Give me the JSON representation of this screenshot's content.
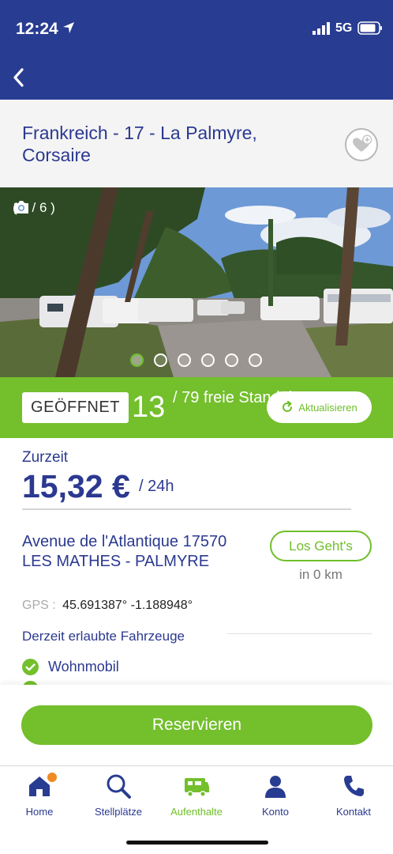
{
  "status_bar": {
    "time": "12:24",
    "network": "5G"
  },
  "title": "Frankreich - 17 - La Palmyre, Corsaire",
  "photo": {
    "counter": "( 1 / 6 )",
    "dots": 6,
    "active_dot": 1
  },
  "availability": {
    "status": "GEÖFFNET",
    "free_count": "13",
    "free_label": "/ 79 freie Standplätze",
    "refresh_label": "Aktualisieren"
  },
  "price": {
    "label": "Zurzeit",
    "value": "15,32 €",
    "unit": "/ 24h"
  },
  "location": {
    "address": "Avenue de l'Atlantique 17570 LES MATHES - PALMYRE",
    "go_label": "Los Geht's",
    "distance": "in 0 km",
    "gps_label": "GPS :",
    "gps_value": "45.691387° -1.188948°"
  },
  "vehicles": {
    "title": "Derzeit erlaubte Fahrzeuge",
    "items": [
      "Wohnmobil"
    ]
  },
  "reserve_label": "Reservieren",
  "tabs": [
    {
      "label": "Home",
      "icon": "home-icon"
    },
    {
      "label": "Stellplätze",
      "icon": "search-icon"
    },
    {
      "label": "Aufenthalte",
      "icon": "camper-icon"
    },
    {
      "label": "Konto",
      "icon": "user-icon"
    },
    {
      "label": "Kontakt",
      "icon": "phone-icon"
    }
  ],
  "colors": {
    "primary": "#283c91",
    "accent": "#73bf2c",
    "badge": "#f08a24"
  }
}
